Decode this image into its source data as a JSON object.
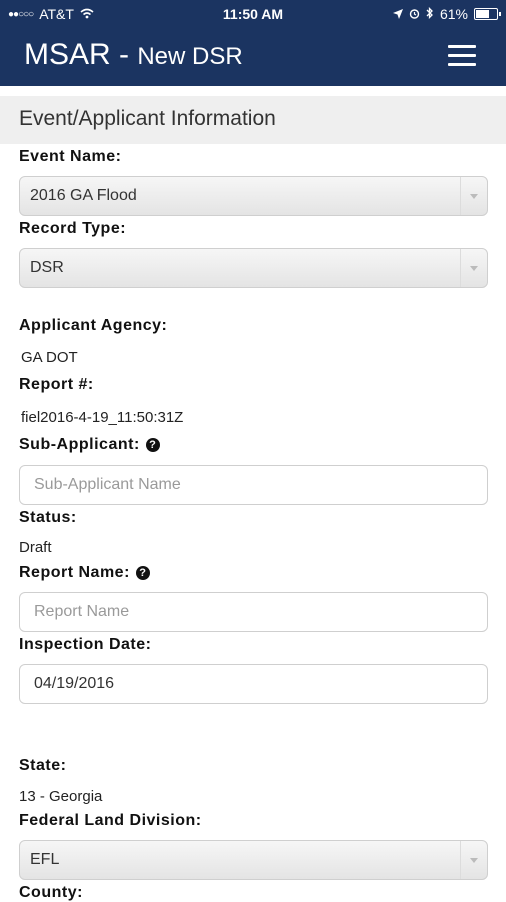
{
  "status_bar": {
    "carrier": "AT&T",
    "time": "11:50 AM",
    "battery": "61%",
    "battery_level": 0.61
  },
  "app_bar": {
    "brand": "MSAR -",
    "screen_title": "New DSR",
    "menu_icon": "hamburger-menu-icon"
  },
  "section": {
    "title": "Event/Applicant Information"
  },
  "form": {
    "event_name": {
      "label": "Event Name:",
      "value": "2016 GA Flood"
    },
    "record_type": {
      "label": "Record Type:",
      "value": "DSR"
    },
    "applicant_agency": {
      "label": "Applicant Agency:",
      "value": "GA DOT"
    },
    "report_number": {
      "label": "Report #:",
      "value": "fiel2016-4-19_11:50:31Z"
    },
    "sub_applicant": {
      "label": "Sub-Applicant:",
      "placeholder": "Sub-Applicant Name",
      "value": ""
    },
    "status": {
      "label": "Status:",
      "value": "Draft"
    },
    "report_name": {
      "label": "Report Name:",
      "placeholder": "Report Name",
      "value": ""
    },
    "inspection_date": {
      "label": "Inspection Date:",
      "value": "04/19/2016"
    },
    "state": {
      "label": "State:",
      "value": "13 - Georgia"
    },
    "federal_land_division": {
      "label": "Federal Land Division:",
      "value": "EFL"
    },
    "county": {
      "label": "County:"
    }
  },
  "colors": {
    "header_bg": "#1b3461",
    "section_bg": "#efefef"
  }
}
